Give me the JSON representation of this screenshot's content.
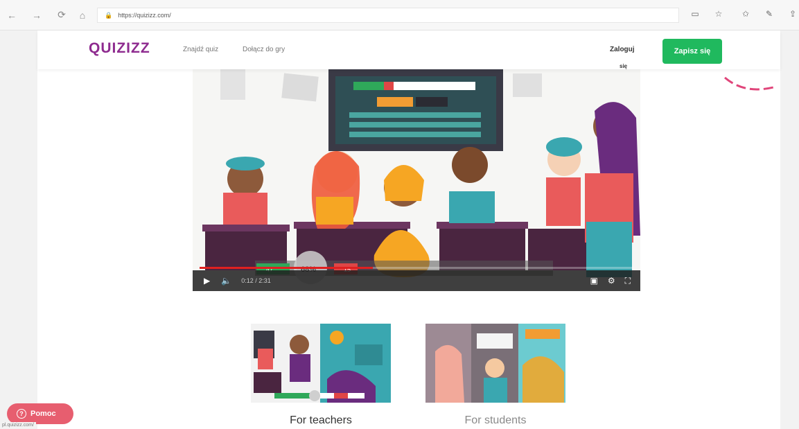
{
  "browser": {
    "url": "https://quizizz.com/",
    "icons": [
      "back-icon",
      "forward-icon",
      "refresh-icon",
      "home-icon",
      "reading-view-icon",
      "favorite-star-icon",
      "favorites-icon",
      "pen-icon",
      "share-icon"
    ]
  },
  "header": {
    "logo": "QUIZIZZ",
    "nav": [
      "Znajdź quiz",
      "Dołącz do gry"
    ],
    "login": "Zaloguj",
    "login_2": "się",
    "signup": "Zapisz się"
  },
  "video": {
    "time": "0:12 / 2:31",
    "progress": 0.4,
    "score_left": "47",
    "score_right": "15",
    "percent": "68%"
  },
  "cards": [
    {
      "label": "For teachers"
    },
    {
      "label": "For students"
    }
  ],
  "help": {
    "label": "Pomoc"
  },
  "status_url": "pl.quizizz.com/",
  "colors": {
    "brand_green": "#20b95e",
    "brand_purple": "#8e2b8f",
    "help_pink": "#e75e6f"
  }
}
